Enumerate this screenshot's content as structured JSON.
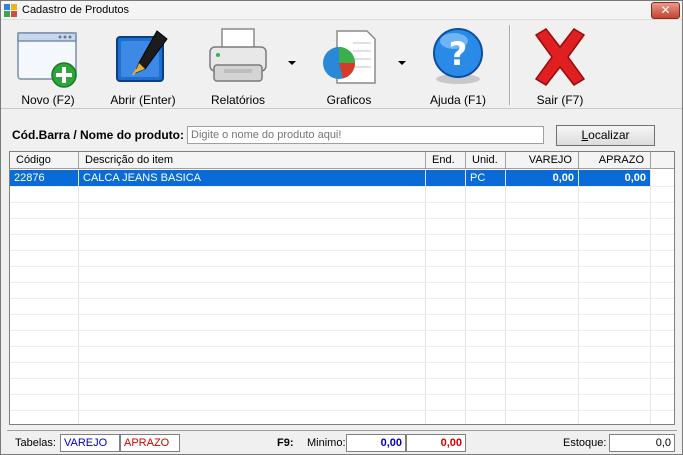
{
  "window": {
    "title": "Cadastro de Produtos",
    "close_label": "✕"
  },
  "toolbar": {
    "novo": "Novo (F2)",
    "abrir": "Abrir (Enter)",
    "relatorios": "Relatórios",
    "graficos": "Graficos",
    "ajuda": "Ajuda (F1)",
    "sair": "Sair (F7)"
  },
  "search": {
    "label": "Cód.Barra / Nome do produto:",
    "placeholder": "Digite o nome do produto aqui!",
    "button_prefix": "",
    "button_hotkey": "L",
    "button_rest": "ocalizar"
  },
  "grid": {
    "columns": [
      "Código",
      "Descrição do item",
      "End.",
      "Unid.",
      "VAREJO",
      "APRAZO"
    ],
    "rows": [
      {
        "codigo": "22876",
        "descricao": "CALCA JEANS BASICA",
        "end": "",
        "unid": "PC",
        "varejo": "0,00",
        "aprazo": "0,00"
      }
    ]
  },
  "status": {
    "tabelas_label": "Tabelas:",
    "tab_varejo": "VAREJO",
    "tab_aprazo": "APRAZO",
    "f9_label": "F9:",
    "minimo_label": "Minimo:",
    "minimo_varejo": "0,00",
    "minimo_aprazo": "0,00",
    "estoque_label": "Estoque:",
    "estoque_value": "0,0"
  },
  "colors": {
    "selection": "#0a6ad8",
    "blue_text": "#0000c0",
    "red_text": "#d00000"
  }
}
